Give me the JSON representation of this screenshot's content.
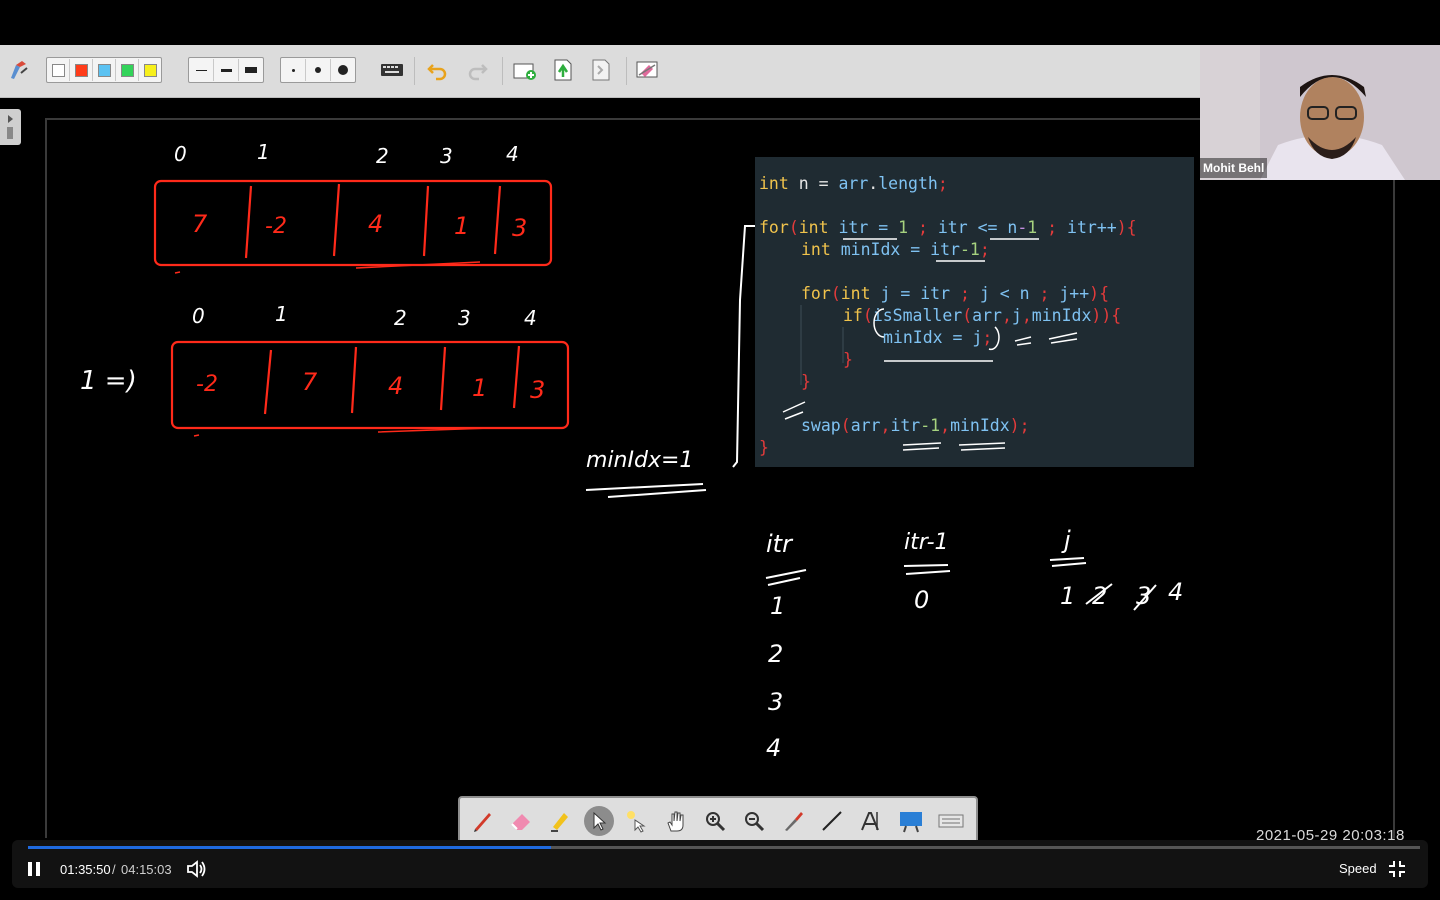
{
  "code": {
    "line1": {
      "a": "int",
      "b": " n = ",
      "c": "arr",
      "d": ".",
      "e": "length",
      "f": ";"
    },
    "line2": {
      "a": "for",
      "b": "(",
      "c": "int",
      "d": " itr = ",
      "e": "1",
      "f": " ; ",
      "g": "itr <= n",
      "h": "-",
      "i": "1",
      "j": " ; ",
      "k": "itr++",
      "l": "){"
    },
    "line3": {
      "a": "int",
      "b": " minIdx = ",
      "c": "itr",
      "d": "-1",
      "e": ";"
    },
    "line4": {
      "a": "for",
      "b": "(",
      "c": "int",
      "d": " j = ",
      "e": "itr",
      "f": " ; ",
      "g": "j < n",
      "h": " ; ",
      "i": "j++",
      "j": "){"
    },
    "line5": {
      "a": "if",
      "b": "(",
      "c": "isSmaller",
      "d": "(",
      "e": "arr",
      "f": ",",
      "g": "j",
      "h": ",",
      "i": "minIdx",
      "j": ")){"
    },
    "line6": {
      "a": "minIdx = j",
      "b": ";"
    },
    "line7": {
      "a": "}"
    },
    "line8": {
      "a": "}"
    },
    "line9": {
      "a": "swap",
      "b": "(",
      "c": "arr",
      "d": ",",
      "e": "itr",
      "f": "-1",
      ",": ",",
      "g": "minIdx",
      "h": ");"
    },
    "line10": {
      "a": "}"
    }
  },
  "board": {
    "indices_top": [
      "0",
      "1",
      "2",
      "3",
      "4"
    ],
    "array_top": [
      "7",
      "-2",
      "4",
      "1",
      "3"
    ],
    "indices_bottom": [
      "0",
      "1",
      "2",
      "3",
      "4"
    ],
    "array_bottom": [
      "-2",
      "7",
      "4",
      "1",
      "3"
    ],
    "pass_label": "1 =)",
    "min_label": "minIdx=1",
    "col_itr_header": "itr",
    "col_itr_values": [
      "1",
      "2",
      "3",
      "4"
    ],
    "col_itr1_header": "itr-1",
    "col_itr1_values": [
      "0"
    ],
    "col_j_header": "j",
    "col_j_values": [
      "1",
      "2",
      "3",
      "4"
    ]
  },
  "webcam": {
    "name": "Mohit Behl"
  },
  "toolbar": {
    "colors": [
      "#ffffff",
      "#ff3c1a",
      "#5bc2f2",
      "#33d35a",
      "#f7f01c"
    ]
  },
  "player": {
    "current_time": "01:35:50",
    "separator": "/",
    "total_time": "04:15:03",
    "speed_label": "Speed",
    "progress": 0.376,
    "timestamp": "2021-05-29  20:03:18"
  }
}
